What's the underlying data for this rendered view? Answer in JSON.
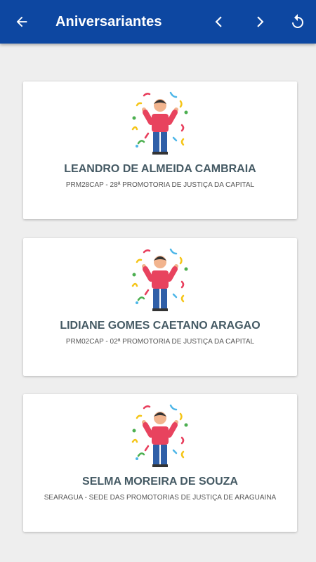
{
  "appbar": {
    "title": "Aniversariantes",
    "back_icon": "arrow-left-icon",
    "prev_icon": "chevron-left-icon",
    "next_icon": "chevron-right-icon",
    "refresh_icon": "refresh-icon",
    "color": "#0d47a1"
  },
  "cards": [
    {
      "name": "LEANDRO DE ALMEIDA CAMBRAIA",
      "org": "PRM28CAP - 28ª PROMOTORIA DE JUSTIÇA DA CAPITAL",
      "icon": "celebrating-person-icon"
    },
    {
      "name": "LIDIANE GOMES CAETANO ARAGAO",
      "org": "PRM02CAP - 02ª PROMOTORIA DE JUSTIÇA DA CAPITAL",
      "icon": "celebrating-person-icon"
    },
    {
      "name": "SELMA MOREIRA DE SOUZA",
      "org": "SEARAGUA - SEDE DAS PROMOTORIAS DE JUSTIÇA DE ARAGUAINA",
      "icon": "celebrating-person-icon"
    }
  ]
}
